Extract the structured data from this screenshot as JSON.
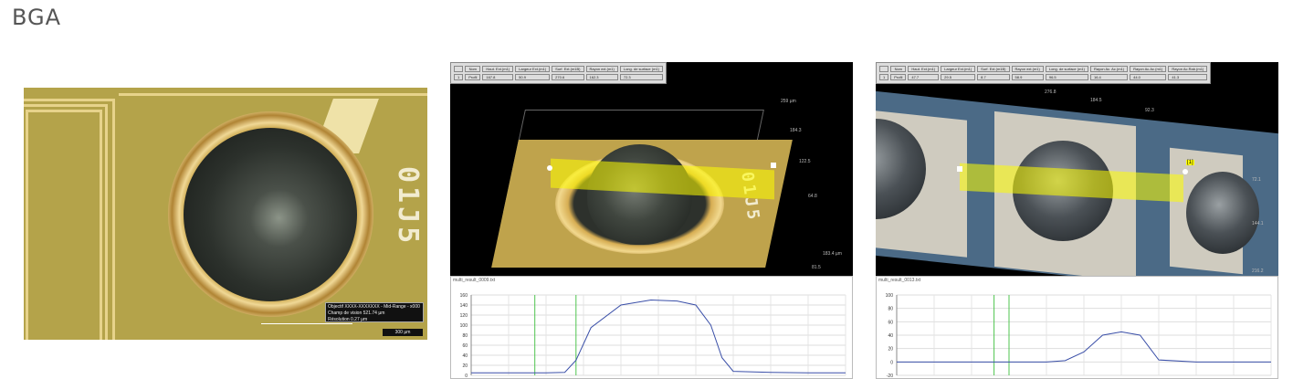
{
  "page": {
    "title": "BGA"
  },
  "photo": {
    "marking": "01J5",
    "legend": [
      "Objectif            XXXX-XXXXXXX - Mid-Range - x000",
      "Champ de vision     521.74 µm",
      "Résolution          0.27 µm"
    ],
    "scale_label": "300 µm"
  },
  "panel_b": {
    "window_title": "multi_result_0009.txt",
    "table_headers": [
      "Nom",
      "Haut. Ext.(m1)",
      "Largeur Ext.(m1)",
      "Surf. Ext.(m1B)",
      "Rayon ext.(m1)",
      "Long. de surface (m1)"
    ],
    "table_row": [
      "1",
      "Profil",
      "167.8",
      "50.9",
      "270.6",
      "162.3",
      "72.3"
    ],
    "marking": "01J5",
    "axis_labels": [
      "259 µm",
      "184.3",
      "122.5",
      "64.8",
      "183.4 µm",
      "81.5"
    ]
  },
  "panel_c": {
    "window_title": "multi_result_0013.txt",
    "table_headers": [
      "Nom",
      "Haut. Ext.(m1)",
      "Largeur Ext.(m1)",
      "Surf. Ext.(m1B)",
      "Rayon ext.(m1)",
      "Long. de surface (m1)",
      "Rayon Ac. Ac.(m1)",
      "Rayon Ac.Ac.(m1)",
      "Rayon Ac.Rab.(m1)"
    ],
    "table_row": [
      "1",
      "Profil",
      "47.7",
      "29.5",
      "8.7",
      "58.9",
      "96.5",
      "16.4",
      "44.0",
      "41.3"
    ],
    "axis_labels": [
      "276.8",
      "184.5",
      "92.3",
      "72.1",
      "144.1",
      "216.2"
    ],
    "marker": "[1]"
  },
  "graph_b": {
    "caption": "multi_result_0009.txt",
    "y_ticks": [
      "160",
      "140",
      "120",
      "100",
      "80",
      "60",
      "40",
      "20",
      "0"
    ]
  },
  "graph_c": {
    "caption": "multi_result_0013.txt",
    "y_ticks": [
      "100",
      "80",
      "60",
      "40",
      "20",
      "0",
      "-20"
    ]
  },
  "chart_data": [
    {
      "type": "line",
      "x": [
        0,
        10,
        20,
        25,
        28,
        32,
        40,
        48,
        55,
        60,
        64,
        67,
        70,
        80,
        90,
        100
      ],
      "series": [
        {
          "values": [
            5,
            5,
            5,
            6,
            30,
            95,
            140,
            150,
            148,
            140,
            100,
            35,
            8,
            6,
            5,
            5
          ]
        }
      ],
      "ylim": [
        0,
        160
      ],
      "grid": true
    },
    {
      "type": "line",
      "x": [
        0,
        10,
        20,
        30,
        40,
        45,
        50,
        55,
        60,
        65,
        70,
        80,
        90,
        100
      ],
      "series": [
        {
          "values": [
            0,
            0,
            0,
            0,
            0,
            2,
            15,
            40,
            45,
            40,
            3,
            0,
            0,
            0
          ]
        }
      ],
      "ylim": [
        -20,
        100
      ],
      "grid": true
    }
  ]
}
